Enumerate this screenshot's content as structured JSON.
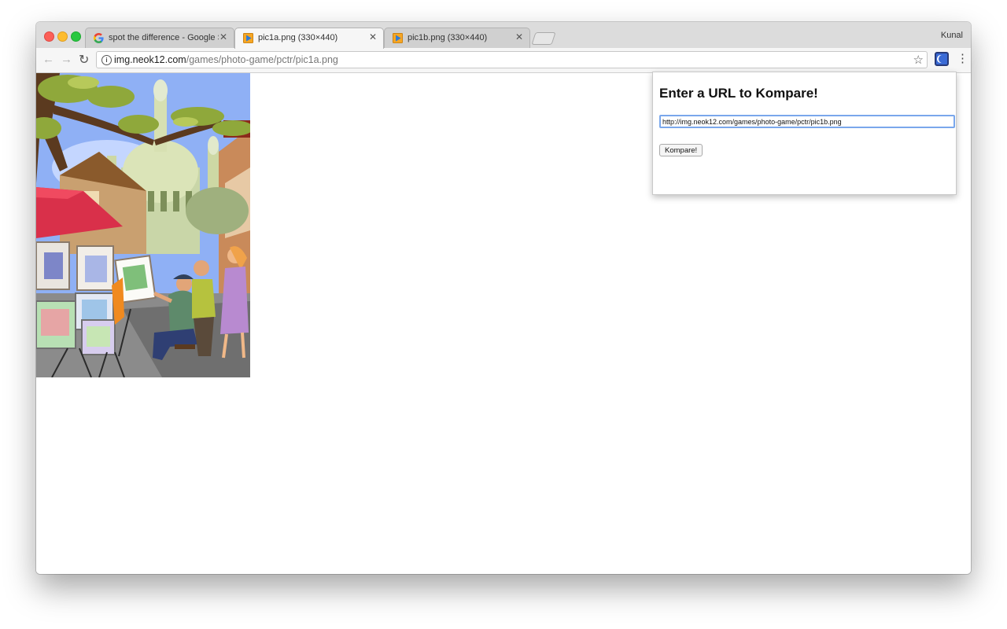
{
  "browser": {
    "profile_name": "Kunal",
    "tabs": [
      {
        "title": "spot the difference - Google S",
        "favicon": "google-icon"
      },
      {
        "title": "pic1a.png (330×440)",
        "favicon": "image-icon"
      },
      {
        "title": "pic1b.png (330×440)",
        "favicon": "image-icon"
      }
    ],
    "address": {
      "host": "img.neok12.com",
      "path": "/games/photo-game/pctr/pic1a.png"
    },
    "icons": {
      "back": "back-arrow-icon",
      "forward": "forward-arrow-icon",
      "reload": "reload-icon",
      "info": "info-icon",
      "star": "bookmark-star-icon",
      "extension": "kompare-extension-icon",
      "menu": "menu-dots-icon"
    }
  },
  "popup": {
    "heading": "Enter a URL to Kompare!",
    "url_value": "http://img.neok12.com/games/photo-game/pctr/pic1b.png",
    "button_label": "Kompare!"
  },
  "colors": {
    "accent_focus": "#7aa7ec",
    "extension_blue": "#3b6bd6"
  }
}
